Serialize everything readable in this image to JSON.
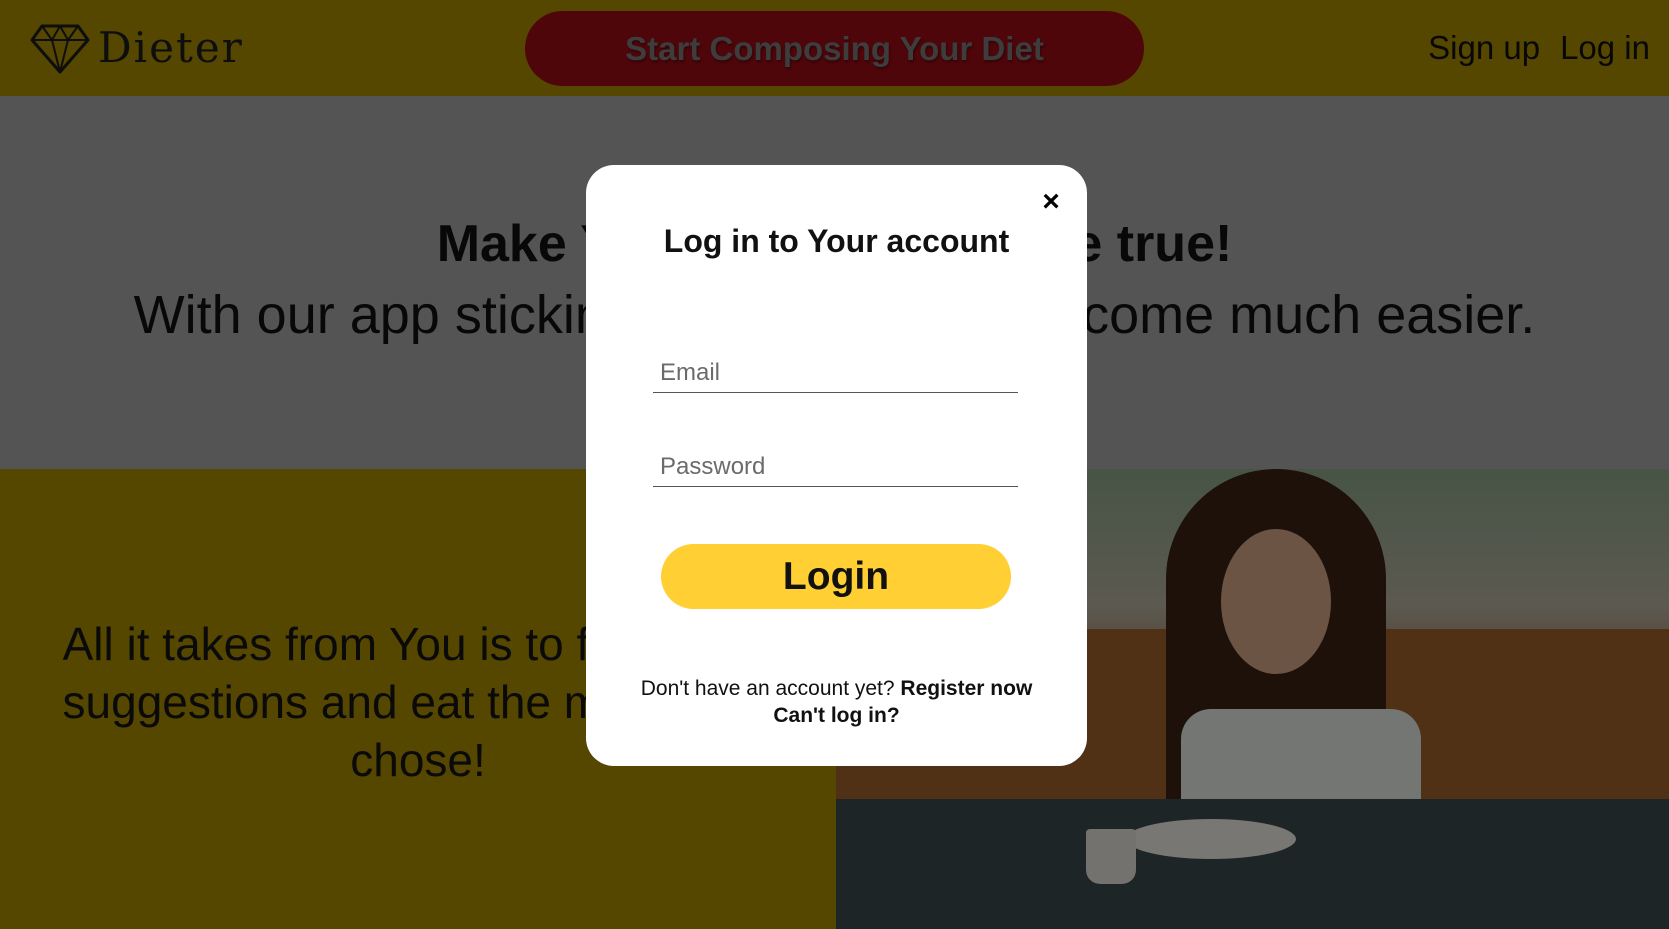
{
  "navbar": {
    "brand_name": "Dieter",
    "cta_label": "Start Composing Your Diet",
    "signup_label": "Sign up",
    "login_label": "Log in"
  },
  "hero": {
    "title": "Make Your diet plans come true!",
    "subtitle": "With our app sticking to your diet will become much easier."
  },
  "feature": {
    "text": "All it takes from You is to follow our suggestions and eat the meals you chose!"
  },
  "modal": {
    "close_label": "×",
    "title": "Log in to Your account",
    "email_placeholder": "Email",
    "password_placeholder": "Password",
    "login_button": "Login",
    "no_account_text": "Don't have an account yet?",
    "register_link": "Register now",
    "cant_login_link": "Can't log in?"
  },
  "colors": {
    "navbar_bg": "#ab8d00",
    "cta_bg": "#9c0c14",
    "login_button_bg": "#ffcf33",
    "modal_bg": "#ffffff"
  },
  "icons": {
    "brand_logo": "diamond-heart-logo-icon",
    "close": "close-icon"
  }
}
